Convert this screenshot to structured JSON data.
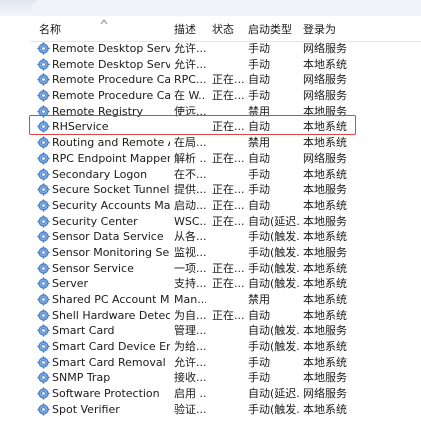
{
  "header": {
    "name": "名称",
    "desc": "描述",
    "status": "状态",
    "startup": "启动类型",
    "logon": "登录为"
  },
  "rows": [
    {
      "name": "Remote Desktop Services",
      "desc": "允许...",
      "status": "",
      "startup": "手动",
      "logon": "网络服务"
    },
    {
      "name": "Remote Desktop Services ...",
      "desc": "允许...",
      "status": "",
      "startup": "手动",
      "logon": "本地系统"
    },
    {
      "name": "Remote Procedure Call (R...",
      "desc": "RPC...",
      "status": "正在...",
      "startup": "自动",
      "logon": "网络服务"
    },
    {
      "name": "Remote Procedure Call (R...",
      "desc": "在 W...",
      "status": "正在...",
      "startup": "手动",
      "logon": "网络服务"
    },
    {
      "name": "Remote Registry",
      "desc": "使远...",
      "status": "",
      "startup": "禁用",
      "logon": "本地服务"
    },
    {
      "name": "RHService",
      "desc": "",
      "status": "正在...",
      "startup": "自动",
      "logon": "本地系统"
    },
    {
      "name": "Routing and Remote Access",
      "desc": "在局...",
      "status": "",
      "startup": "禁用",
      "logon": "本地系统"
    },
    {
      "name": "RPC Endpoint Mapper",
      "desc": "解析 ...",
      "status": "正在...",
      "startup": "自动",
      "logon": "网络服务"
    },
    {
      "name": "Secondary Logon",
      "desc": "在不...",
      "status": "",
      "startup": "手动",
      "logon": "本地系统"
    },
    {
      "name": "Secure Socket Tunneling P...",
      "desc": "提供...",
      "status": "正在...",
      "startup": "手动",
      "logon": "本地服务"
    },
    {
      "name": "Security Accounts Manager",
      "desc": "启动...",
      "status": "正在...",
      "startup": "自动",
      "logon": "本地系统"
    },
    {
      "name": "Security Center",
      "desc": "WSC...",
      "status": "正在...",
      "startup": "自动(延迟...",
      "logon": "本地服务"
    },
    {
      "name": "Sensor Data Service",
      "desc": "从各...",
      "status": "",
      "startup": "手动(触发...",
      "logon": "本地系统"
    },
    {
      "name": "Sensor Monitoring Service",
      "desc": "监视...",
      "status": "",
      "startup": "手动(触发...",
      "logon": "本地服务"
    },
    {
      "name": "Sensor Service",
      "desc": "一项...",
      "status": "正在...",
      "startup": "手动(触发...",
      "logon": "本地系统"
    },
    {
      "name": "Server",
      "desc": "支持...",
      "status": "正在...",
      "startup": "自动(触发...",
      "logon": "本地系统"
    },
    {
      "name": "Shared PC Account Manager",
      "desc": "Man...",
      "status": "",
      "startup": "禁用",
      "logon": "本地系统"
    },
    {
      "name": "Shell Hardware Detection",
      "desc": "为自...",
      "status": "正在...",
      "startup": "自动",
      "logon": "本地系统"
    },
    {
      "name": "Smart Card",
      "desc": "管理...",
      "status": "",
      "startup": "自动(触发...",
      "logon": "本地服务"
    },
    {
      "name": "Smart Card Device Enumer...",
      "desc": "为给...",
      "status": "",
      "startup": "手动(触发...",
      "logon": "本地系统"
    },
    {
      "name": "Smart Card Removal Policy",
      "desc": "允许...",
      "status": "",
      "startup": "手动",
      "logon": "本地系统"
    },
    {
      "name": "SNMP Trap",
      "desc": "接收...",
      "status": "",
      "startup": "手动",
      "logon": "本地服务"
    },
    {
      "name": "Software Protection",
      "desc": "启用 ...",
      "status": "",
      "startup": "自动(延迟...",
      "logon": "网络服务"
    },
    {
      "name": "Spot Verifier",
      "desc": "验证...",
      "status": "",
      "startup": "手动(触发...",
      "logon": "本地系统"
    }
  ],
  "icons": {
    "row_icon": "gear-service-icon",
    "sort_indicator": "sort-up-icon"
  },
  "colors": {
    "highlight_border": "#e0453d",
    "gear_blue": "#3a78c9"
  }
}
